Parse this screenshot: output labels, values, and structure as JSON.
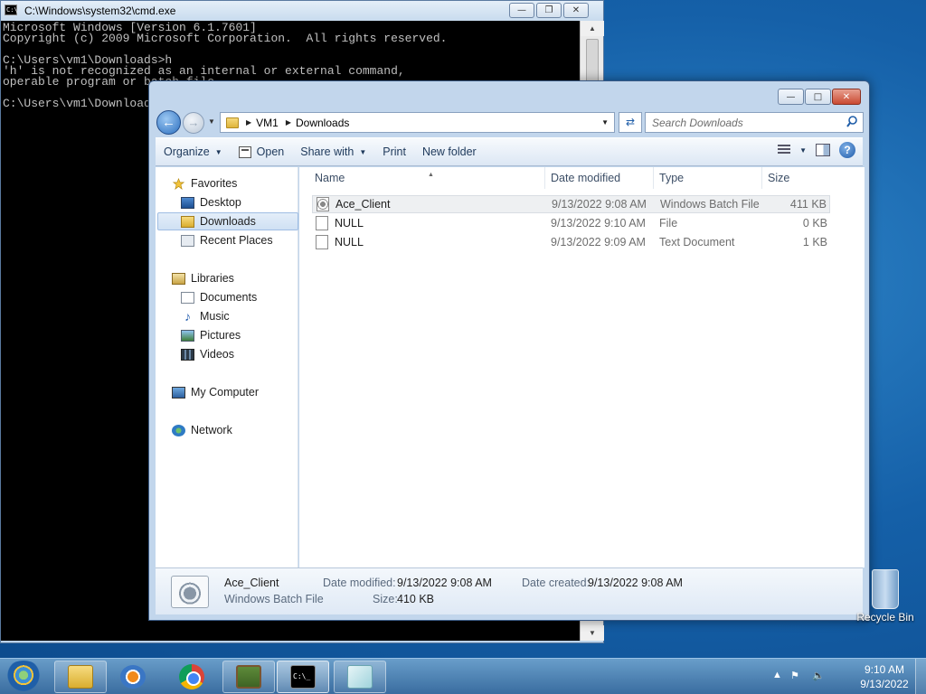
{
  "cmd": {
    "title": "C:\\Windows\\system32\\cmd.exe",
    "lines": [
      "Microsoft Windows [Version 6.1.7601]",
      "Copyright (c) 2009 Microsoft Corporation.  All rights reserved.",
      "",
      "C:\\Users\\vm1\\Downloads>h",
      "'h' is not recognized as an internal or external command,",
      "operable program or batch file.",
      "",
      "C:\\Users\\vm1\\Downloads>"
    ]
  },
  "explorer": {
    "breadcrumb": [
      "VM1",
      "Downloads"
    ],
    "search_placeholder": "Search Downloads",
    "toolbar": {
      "organize": "Organize",
      "open": "Open",
      "share_with": "Share with",
      "print": "Print",
      "new_folder": "New folder"
    },
    "nav": {
      "favorites": "Favorites",
      "desktop": "Desktop",
      "downloads": "Downloads",
      "recent_places": "Recent Places",
      "libraries": "Libraries",
      "documents": "Documents",
      "music": "Music",
      "pictures": "Pictures",
      "videos": "Videos",
      "my_computer": "My Computer",
      "network": "Network"
    },
    "columns": {
      "name": "Name",
      "date_modified": "Date modified",
      "type": "Type",
      "size": "Size"
    },
    "files": [
      {
        "name": "Ace_Client",
        "date": "9/13/2022 9:08 AM",
        "type": "Windows Batch File",
        "size": "411 KB"
      },
      {
        "name": "NULL",
        "date": "9/13/2022 9:10 AM",
        "type": "File",
        "size": "0 KB"
      },
      {
        "name": "NULL",
        "date": "9/13/2022 9:09 AM",
        "type": "Text Document",
        "size": "1 KB"
      }
    ],
    "details": {
      "name": "Ace_Client",
      "type": "Windows Batch File",
      "date_modified_label": "Date modified:",
      "date_modified": "9/13/2022 9:08 AM",
      "date_created_label": "Date created:",
      "date_created": "9/13/2022 9:08 AM",
      "size_label": "Size:",
      "size": "410 KB"
    }
  },
  "desktop": {
    "recycle_bin": "Recycle Bin"
  },
  "taskbar": {
    "time": "9:10 AM",
    "date": "9/13/2022"
  },
  "colors": {
    "desktop_blue": "#1560a8",
    "close_red": "#c94a32",
    "selection_blue": "#cfe0f3"
  }
}
